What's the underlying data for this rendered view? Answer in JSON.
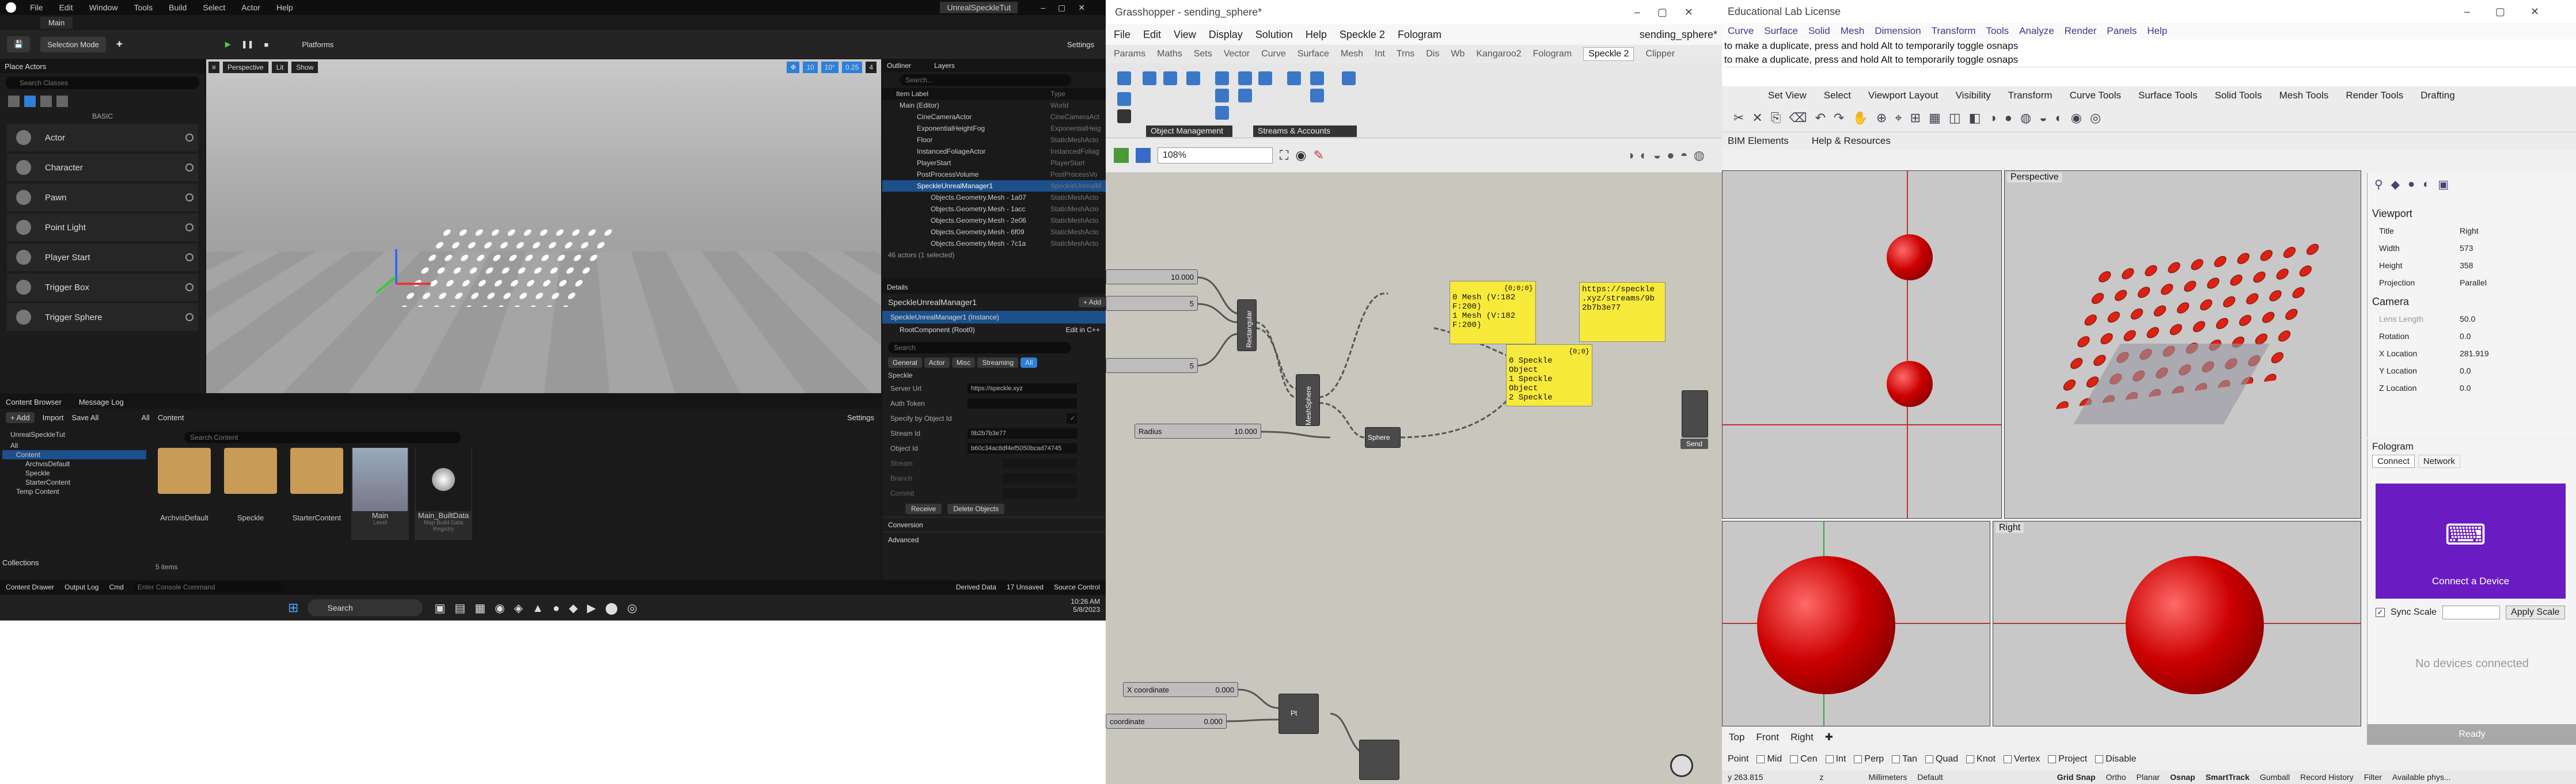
{
  "unreal": {
    "project": "UnrealSpeckleTut",
    "menu": [
      "File",
      "Edit",
      "Window",
      "Tools",
      "Build",
      "Select",
      "Actor",
      "Help"
    ],
    "level_tab": "Main",
    "selection_mode": "Selection Mode",
    "platforms": "Platforms",
    "settings": "Settings",
    "place_actors": {
      "title": "Place Actors",
      "search": "Search Classes",
      "category": "BASIC",
      "items": [
        "Actor",
        "Character",
        "Pawn",
        "Point Light",
        "Player Start",
        "Trigger Box",
        "Trigger Sphere"
      ]
    },
    "viewport": {
      "mode": "Perspective",
      "lit": "Lit",
      "show": "Show",
      "snap_grid": "10",
      "snap_rot": "10°",
      "snap_scale": "0.25",
      "cam_speed": "4"
    },
    "outliner": {
      "title": "Outliner",
      "tab2": "Layers",
      "search": "Search...",
      "col_label": "Item Label",
      "col_type": "Type",
      "rows": [
        {
          "label": "Main (Editor)",
          "type": "World"
        },
        {
          "label": "CineCameraActor",
          "type": "CineCameraAct"
        },
        {
          "label": "ExponentialHeightFog",
          "type": "ExponentialHeig"
        },
        {
          "label": "Floor",
          "type": "StaticMeshActo"
        },
        {
          "label": "InstancedFoliageActor",
          "type": "InstancedFoliag"
        },
        {
          "label": "PlayerStart",
          "type": "PlayerStart"
        },
        {
          "label": "PostProcessVolume",
          "type": "PostProcessVo"
        },
        {
          "label": "SpeckleUnrealManager1",
          "type": "SpeckleUnrealM"
        },
        {
          "label": "Objects.Geometry.Mesh - 1a07",
          "type": "StaticMeshActo"
        },
        {
          "label": "Objects.Geometry.Mesh - 1acc",
          "type": "StaticMeshActo"
        },
        {
          "label": "Objects.Geometry.Mesh - 2e06",
          "type": "StaticMeshActo"
        },
        {
          "label": "Objects.Geometry.Mesh - 6f09",
          "type": "StaticMeshActo"
        },
        {
          "label": "Objects.Geometry.Mesh - 7c1a",
          "type": "StaticMeshActo"
        }
      ],
      "count": "46 actors (1 selected)"
    },
    "details": {
      "title": "Details",
      "actor": "SpeckleUnrealManager1",
      "add": "+ Add",
      "instance": "SpeckleUnrealManager1 (Instance)",
      "root": "RootComponent (Root0)",
      "edit_cpp": "Edit in C++",
      "search": "Search",
      "tabs": [
        "General",
        "Actor",
        "Misc",
        "Streaming",
        "All"
      ],
      "section": "Speckle",
      "rows": [
        {
          "k": "Server Url",
          "v": "https://speckle.xyz"
        },
        {
          "k": "Auth Token",
          "v": ""
        },
        {
          "k": "Specify by Object Id",
          "v": "✓"
        },
        {
          "k": "Stream Id",
          "v": "9b2b7b3e77"
        },
        {
          "k": "Object Id",
          "v": "b60c34ac8df4ef5050bcad74745"
        },
        {
          "k": "Stream",
          "v": ""
        },
        {
          "k": "Branch",
          "v": ""
        },
        {
          "k": "Commit",
          "v": ""
        }
      ],
      "receive": "Receive",
      "delete": "Delete Objects",
      "conversion": "Conversion",
      "advanced": "Advanced"
    },
    "content_browser": {
      "tab": "Content Browser",
      "tab2": "Message Log",
      "add": "+ Add",
      "import": "Import",
      "save_all": "Save All",
      "path": [
        "All",
        "Content"
      ],
      "settings": "Settings",
      "search": "Search Content",
      "tree": [
        "All",
        "Content",
        "ArchvisDefault",
        "Speckle",
        "StarterContent",
        "Temp Content"
      ],
      "tree_root": "UnrealSpeckleTut",
      "collections": "Collections",
      "assets": [
        {
          "name": "ArchvisDefault",
          "kind": "folder"
        },
        {
          "name": "Speckle",
          "kind": "folder"
        },
        {
          "name": "StarterContent",
          "kind": "folder"
        },
        {
          "name": "Main",
          "kind": "level",
          "sub": "Level"
        },
        {
          "name": "Main_BuiltData",
          "kind": "data",
          "sub": "Map Build Data Registry"
        }
      ],
      "count": "5 items"
    },
    "bottom": {
      "drawer": "Content Drawer",
      "output": "Output Log",
      "cmd": "Cmd",
      "console": "Enter Console Command",
      "derived": "Derived Data",
      "unsaved": "17 Unsaved",
      "source": "Source Control"
    },
    "taskbar": {
      "search": "Search",
      "time": "10:26 AM",
      "date": "5/8/2023"
    }
  },
  "grasshopper": {
    "title": "Grasshopper - sending_sphere*",
    "doc": "sending_sphere*",
    "menu": [
      "File",
      "Edit",
      "View",
      "Display",
      "Solution",
      "Help",
      "Speckle 2",
      "Fologram"
    ],
    "tabs": [
      "Params",
      "Maths",
      "Sets",
      "Vector",
      "Curve",
      "Surface",
      "Mesh",
      "Int",
      "Trns",
      "Dis",
      "Wb",
      "Kangaroo2",
      "Fologram",
      "Speckle 2",
      "Clipper"
    ],
    "active_tab": "Speckle 2",
    "groups": [
      "Object Management",
      "Streams & Accounts"
    ],
    "zoom": "108%",
    "sliders": [
      {
        "label": "",
        "value": "10.000"
      },
      {
        "label": "",
        "value": "5"
      },
      {
        "label": "",
        "value": "5"
      },
      {
        "label": "Radius",
        "value": "10.000"
      },
      {
        "label": "X coordinate",
        "value": "0.000"
      },
      {
        "label": "coordinate",
        "value": "0.000"
      }
    ],
    "components": [
      "Rectangular",
      "MeshSphere",
      "Sphere",
      "Send",
      "Pt"
    ],
    "panel1": {
      "header": "{0;0;0}",
      "lines": [
        "0 Mesh (V:182",
        "F:200)",
        "1 Mesh (V:182",
        "F:200)"
      ]
    },
    "panel2": {
      "header": "{0;0}",
      "lines": [
        "0 Speckle",
        "Object",
        "1 Speckle",
        "Object",
        "2 Speckle"
      ]
    },
    "panel3": {
      "lines": [
        "https://speckle",
        ".xyz/streams/9b",
        "2b7b3e77"
      ]
    },
    "send": "Send"
  },
  "rhino": {
    "title": "Educational Lab License",
    "menu": [
      "Curve",
      "Surface",
      "Solid",
      "Mesh",
      "Dimension",
      "Transform",
      "Tools",
      "Analyze",
      "Render",
      "Panels",
      "Help"
    ],
    "cmd_lines": [
      "to make a duplicate, press and hold Alt to temporarily toggle osnaps",
      "to make a duplicate, press and hold Alt to temporarily toggle osnaps"
    ],
    "tabs": [
      "Set View",
      "Select",
      "Viewport Layout",
      "Visibility",
      "Transform",
      "Curve Tools",
      "Surface Tools",
      "Solid Tools",
      "Mesh Tools",
      "Render Tools",
      "Drafting"
    ],
    "bim": "BIM Elements",
    "resources": "Help & Resources",
    "viewports": [
      "Perspective",
      "Right",
      "Top",
      "Front",
      "Right"
    ],
    "properties": {
      "section": "Viewport",
      "rows": [
        {
          "k": "Title",
          "v": "Right"
        },
        {
          "k": "Width",
          "v": "573"
        },
        {
          "k": "Height",
          "v": "358"
        },
        {
          "k": "Projection",
          "v": "Parallel"
        }
      ],
      "camera": "Camera",
      "cam_rows": [
        {
          "k": "Lens Length",
          "v": "50.0"
        },
        {
          "k": "Rotation",
          "v": "0.0"
        },
        {
          "k": "X Location",
          "v": "281.919"
        },
        {
          "k": "Y Location",
          "v": "0.0"
        },
        {
          "k": "Z Location",
          "v": "0.0"
        }
      ]
    },
    "fologram": {
      "title": "Fologram",
      "tabs": [
        "Connect",
        "Network"
      ],
      "connect": "Connect a Device",
      "sync": "Sync Scale",
      "apply": "Apply Scale",
      "none": "No devices connected",
      "ready": "Ready"
    },
    "bottom_tabs": [
      "Top",
      "Front",
      "Right"
    ],
    "osnaps": [
      "Point",
      "Mid",
      "Cen",
      "Int",
      "Perp",
      "Tan",
      "Quad",
      "Knot",
      "Vertex",
      "Project",
      "Disable"
    ],
    "status": [
      "y 263.815",
      "z",
      "Millimeters",
      "Default",
      "Grid Snap",
      "Ortho",
      "Planar",
      "Osnap",
      "SmartTrack",
      "Gumball",
      "Record History",
      "Filter",
      "Available phys..."
    ]
  }
}
